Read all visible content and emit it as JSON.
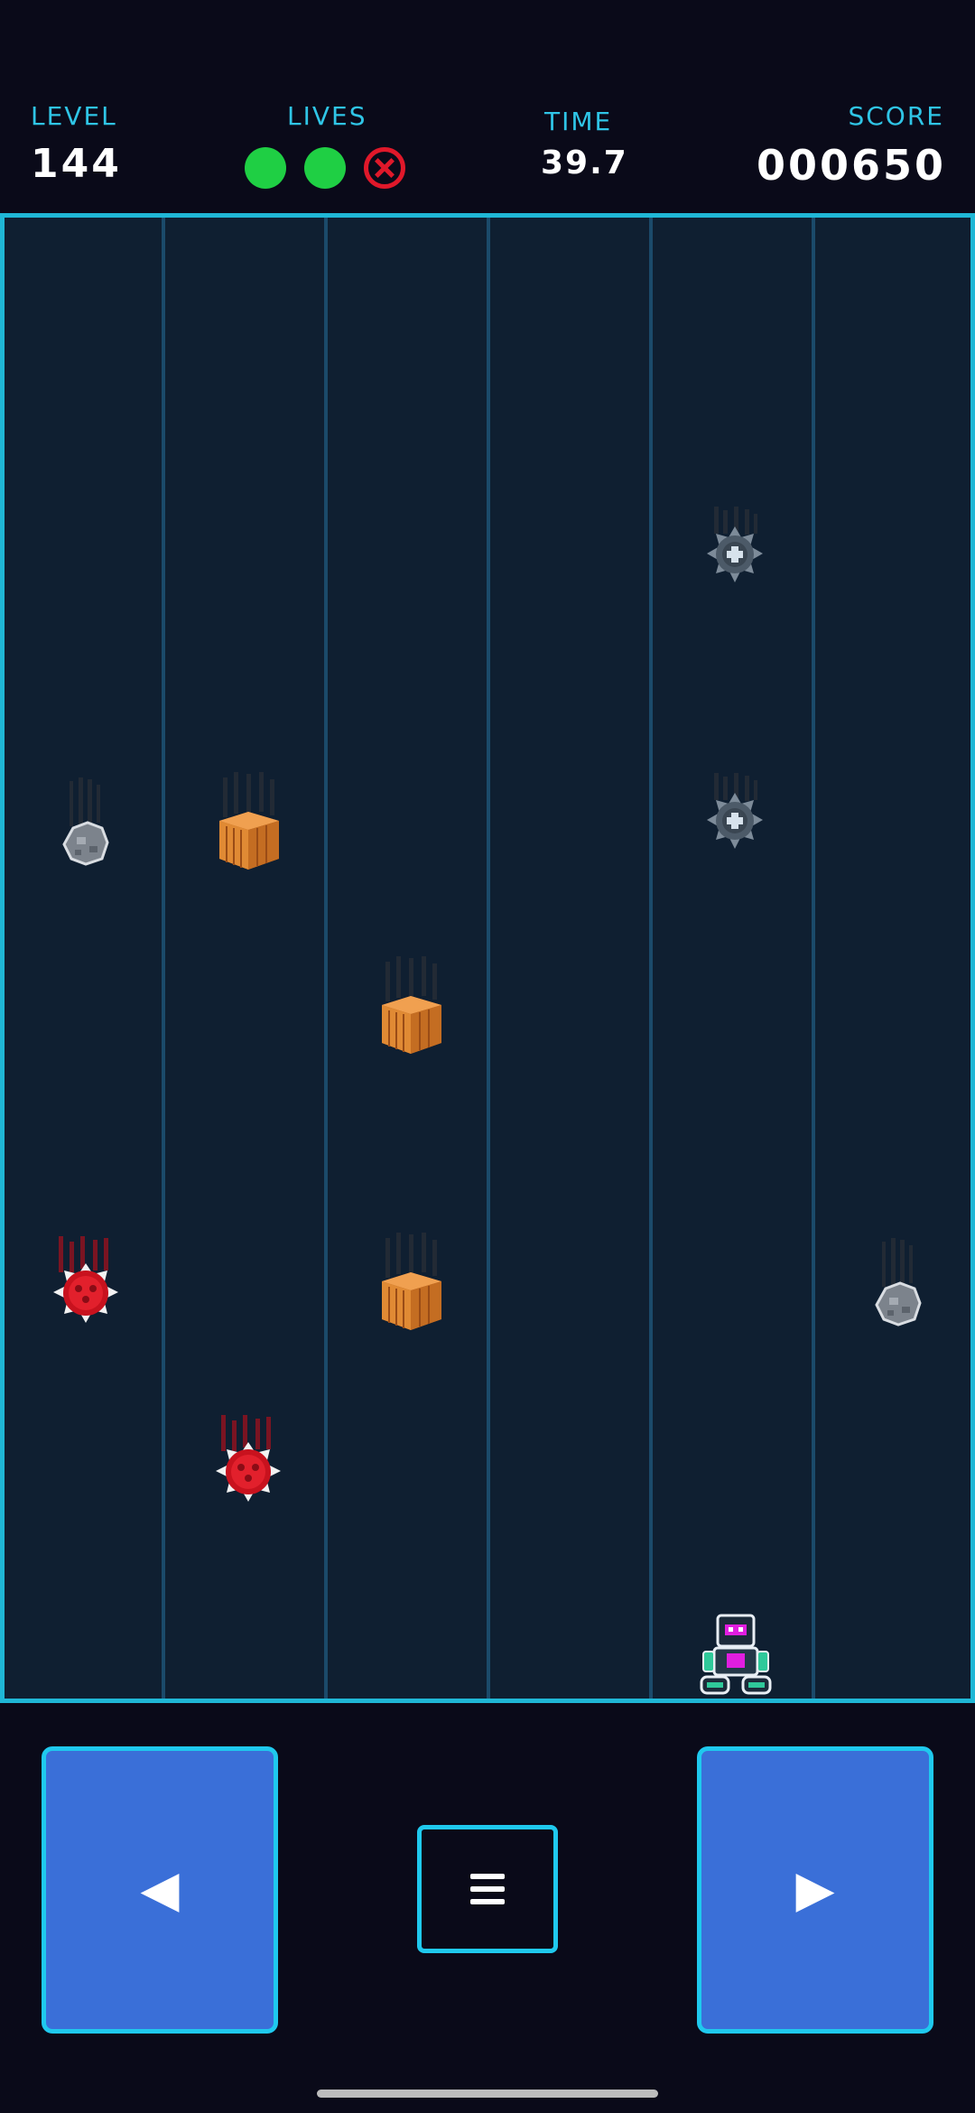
{
  "hud": {
    "level_label": "LEVEL",
    "level_value": "144",
    "lives_label": "LIVES",
    "lives": [
      "full",
      "full",
      "lost"
    ],
    "time_label": "TIME",
    "time_value": "39.7",
    "score_label": "SCORE",
    "score_value": "000650"
  },
  "playfield": {
    "lane_count": 6,
    "border_color": "#1fb7d6",
    "background_color": "#0f1f31",
    "objects": [
      {
        "type": "spike-mine",
        "lane": 5
      },
      {
        "type": "spike-mine",
        "lane": 5
      },
      {
        "type": "rock",
        "lane": 1
      },
      {
        "type": "crate",
        "lane": 2
      },
      {
        "type": "crate",
        "lane": 3
      },
      {
        "type": "red-mine",
        "lane": 1
      },
      {
        "type": "crate",
        "lane": 3
      },
      {
        "type": "rock",
        "lane": 6
      },
      {
        "type": "red-mine",
        "lane": 2
      }
    ],
    "player": {
      "type": "robot",
      "lane": 5
    }
  },
  "controls": {
    "left_label": "◀",
    "menu_icon": "hamburger-menu-icon",
    "right_label": "▶",
    "button_color": "#3a6fd8",
    "accent_color": "#1fc9ee"
  }
}
